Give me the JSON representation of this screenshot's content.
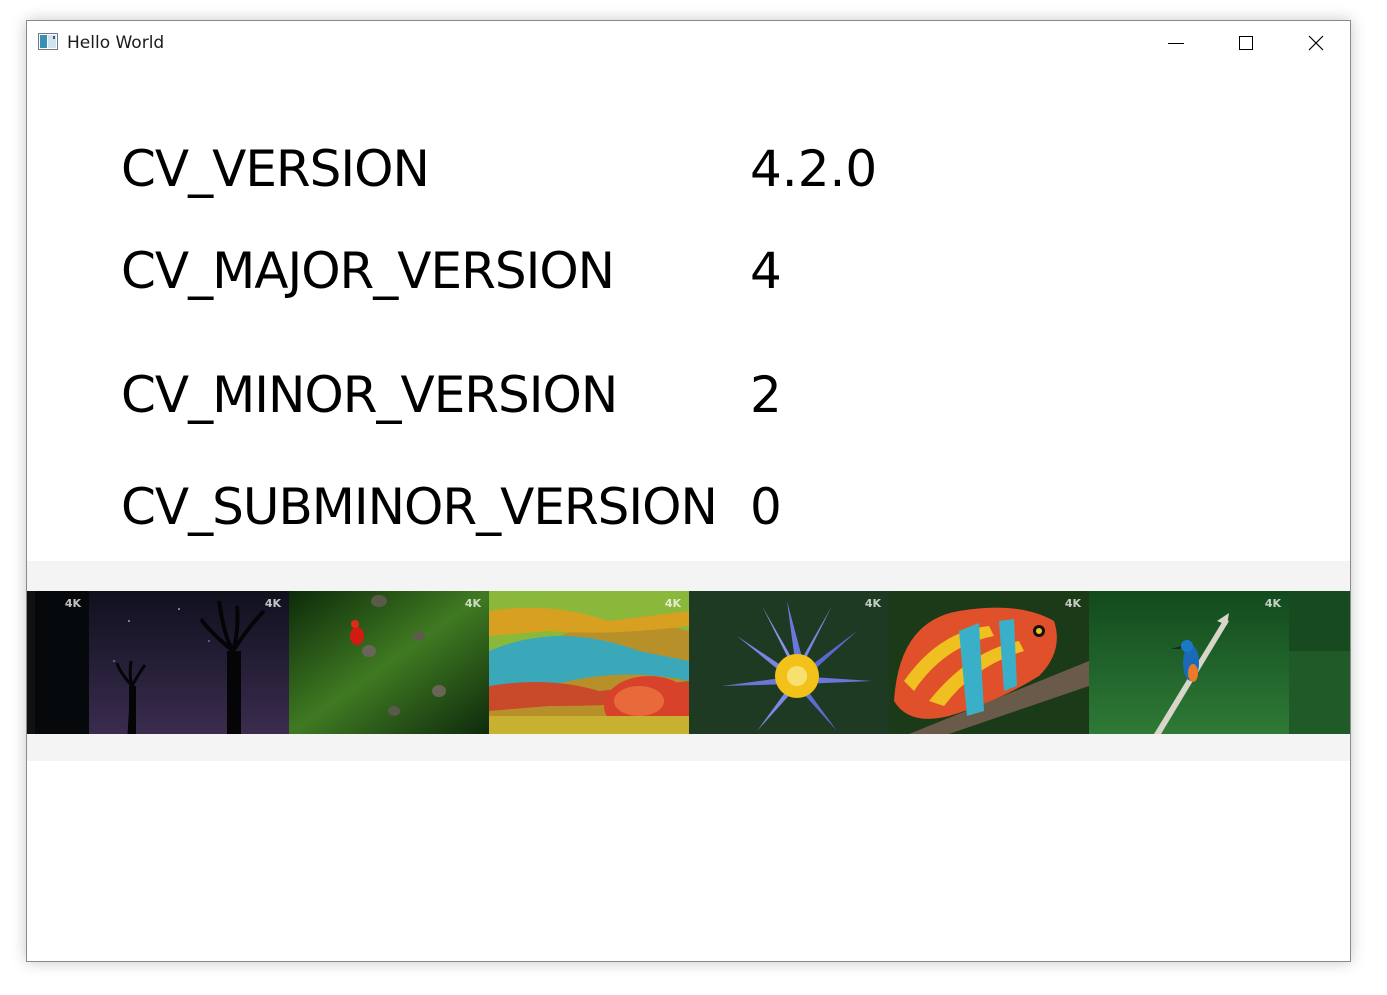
{
  "window": {
    "title": "Hello World",
    "icon": "app-window-icon",
    "controls": {
      "minimize_icon": "minimize-icon",
      "maximize_icon": "maximize-icon",
      "close_icon": "close-icon"
    }
  },
  "versions": [
    {
      "label": "CV_VERSION",
      "value": "4.2.0"
    },
    {
      "label": "CV_MAJOR_VERSION",
      "value": "4"
    },
    {
      "label": "CV_MINOR_VERSION",
      "value": "2"
    },
    {
      "label": "CV_SUBMINOR_VERSION",
      "value": "0"
    }
  ],
  "image_strip": {
    "badge": "4K",
    "images": [
      {
        "subject": "dark-edge",
        "color": "#070a0c"
      },
      {
        "subject": "baobab-trees-at-night",
        "color": "#221d33"
      },
      {
        "subject": "red-frog-on-leaf",
        "color": "#2c5a1a"
      },
      {
        "subject": "chameleon-skin-closeup",
        "color": "#c9a02a"
      },
      {
        "subject": "blue-water-lily",
        "color": "#5b6fd6"
      },
      {
        "subject": "panther-chameleon-on-branch",
        "color": "#d4582a"
      },
      {
        "subject": "kingfisher-on-branch",
        "color": "#1f6a2e"
      },
      {
        "subject": "green-edge",
        "color": "#235a2a"
      }
    ]
  }
}
